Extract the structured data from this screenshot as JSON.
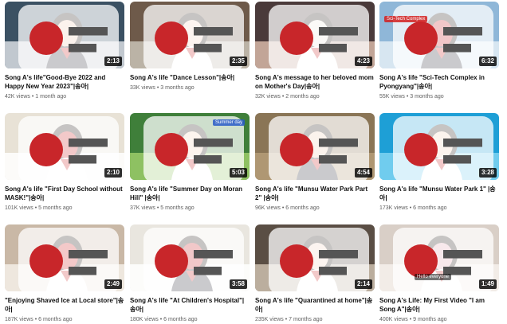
{
  "videos": [
    {
      "title": "Song A's life\"Good-Bye 2022 and Happy New Year 2023\"|송아|",
      "views": "42K views",
      "age": "1 month ago",
      "duration": "2:13",
      "palette": [
        "#3b5163",
        "#d9dde2",
        "#f0c9b4"
      ]
    },
    {
      "title": "Song A's life \"Dance Lesson\"|송아|",
      "views": "33K views",
      "age": "3 months ago",
      "duration": "2:35",
      "palette": [
        "#6e5a4a",
        "#c9c3b6",
        "#f1d3c1"
      ]
    },
    {
      "title": "Song A's message to her beloved mom on Mother's Day|송아|",
      "views": "32K views",
      "age": "2 months ago",
      "duration": "4:23",
      "palette": [
        "#4a3a3a",
        "#d7b9a8",
        "#efe7df"
      ]
    },
    {
      "title": "Song A's life \"Sci-Tech Complex in Pyongyang\"|송아|",
      "views": "55K views",
      "age": "3 months ago",
      "duration": "6:32",
      "palette": [
        "#8fb7d8",
        "#e4eef6",
        "#c8222a"
      ]
    },
    {
      "title": "Song A's life \"First Day School without MASK!\"|송아|",
      "views": "101K views",
      "age": "5 months ago",
      "duration": "2:10",
      "palette": [
        "#e8e2d6",
        "#ffffff",
        "#cc2a2a"
      ]
    },
    {
      "title": "Song A's life \"Summer Day on Moran Hill\" |송아|",
      "views": "37K views",
      "age": "5 months ago",
      "duration": "5:03",
      "palette": [
        "#3f7f3a",
        "#9ccc6a",
        "#f2d2bd"
      ]
    },
    {
      "title": "Song A's life \"Munsu Water Park Part 2\" |송아|",
      "views": "96K views",
      "age": "6 months ago",
      "duration": "4:54",
      "palette": [
        "#8a7556",
        "#b59d78",
        "#f0cdb6"
      ]
    },
    {
      "title": "Song A's life \"Munsu Water Park 1\" |송아|",
      "views": "173K views",
      "age": "6 months ago",
      "duration": "3:28",
      "palette": [
        "#1e9fd6",
        "#7fd3f2",
        "#f3d1bd"
      ]
    },
    {
      "title": "\"Enjoying Shaved Ice at Local store\"|송아|",
      "views": "187K views",
      "age": "6 months ago",
      "duration": "2:49",
      "palette": [
        "#c9b8a6",
        "#f4efe8",
        "#d02b2b"
      ]
    },
    {
      "title": "Song A's life \"At Children's Hospital\"|송아|",
      "views": "180K views",
      "age": "6 months ago",
      "duration": "3:58",
      "palette": [
        "#e9e6df",
        "#ffffff",
        "#c8262a"
      ]
    },
    {
      "title": "Song A's life \"Quarantined at home\"|송아|",
      "views": "235K views",
      "age": "7 months ago",
      "duration": "2:14",
      "palette": [
        "#5a4e44",
        "#cdbfae",
        "#f1d4c3"
      ]
    },
    {
      "title": "Song A's Life: My First Video \"I am Song A\"|송아|",
      "views": "400K views",
      "age": "9 months ago",
      "duration": "1:49",
      "palette": [
        "#d9cfc7",
        "#f6f1ec",
        "#e2a7b5"
      ]
    }
  ],
  "overlays": {
    "v4_tag": "Sci-Tech Complex",
    "v12_caption": "Hello everyone",
    "v6_tag": "Summer day"
  }
}
